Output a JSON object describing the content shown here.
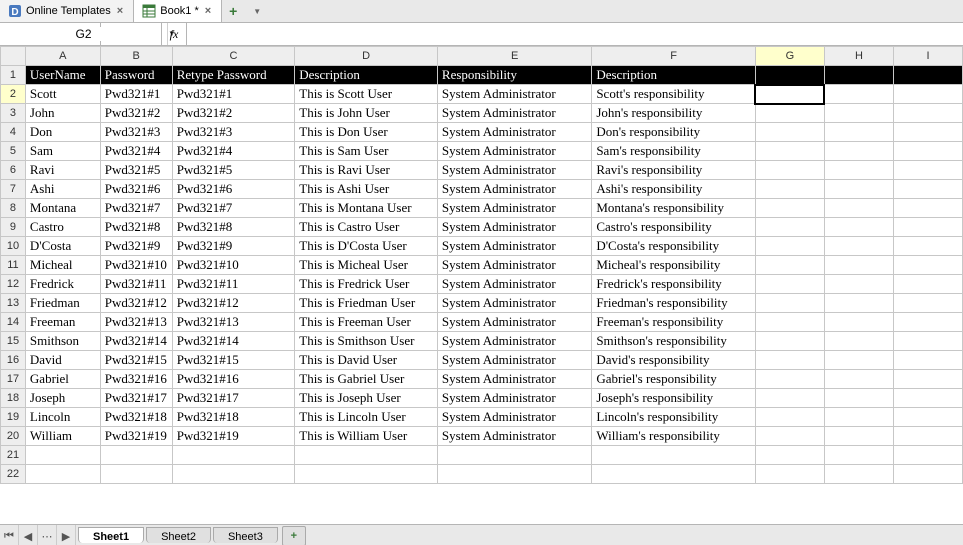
{
  "doc_tabs": [
    {
      "label": "Online Templates",
      "icon": "D",
      "active": false
    },
    {
      "label": "Book1 *",
      "icon": "sheet",
      "active": true
    }
  ],
  "name_box": {
    "value": "G2"
  },
  "fx_label": "fx",
  "formula": {
    "value": ""
  },
  "selection": {
    "col_letter": "G",
    "row_index": 2
  },
  "columns": [
    {
      "letter": "A",
      "width": 75
    },
    {
      "letter": "B",
      "width": 72
    },
    {
      "letter": "C",
      "width": 123
    },
    {
      "letter": "D",
      "width": 143
    },
    {
      "letter": "E",
      "width": 155
    },
    {
      "letter": "F",
      "width": 164
    },
    {
      "letter": "G",
      "width": 70
    },
    {
      "letter": "H",
      "width": 70
    },
    {
      "letter": "I",
      "width": 70
    }
  ],
  "visible_row_count": 22,
  "header_row_index": 1,
  "chart_data": {
    "type": "table",
    "headers": [
      "UserName",
      "Password",
      "Retype Password",
      "Description",
      "Responsibility",
      "Description"
    ],
    "rows": [
      [
        "Scott",
        "Pwd321#1",
        "Pwd321#1",
        "This is Scott User",
        "System Administrator",
        "Scott's responsibility"
      ],
      [
        "John",
        "Pwd321#2",
        "Pwd321#2",
        "This is John User",
        "System Administrator",
        "John's responsibility"
      ],
      [
        "Don",
        "Pwd321#3",
        "Pwd321#3",
        "This is Don User",
        "System Administrator",
        "Don's responsibility"
      ],
      [
        "Sam",
        "Pwd321#4",
        "Pwd321#4",
        "This is Sam User",
        "System Administrator",
        "Sam's responsibility"
      ],
      [
        "Ravi",
        "Pwd321#5",
        "Pwd321#5",
        "This is Ravi User",
        "System Administrator",
        "Ravi's responsibility"
      ],
      [
        "Ashi",
        "Pwd321#6",
        "Pwd321#6",
        "This is Ashi User",
        "System Administrator",
        "Ashi's responsibility"
      ],
      [
        "Montana",
        "Pwd321#7",
        "Pwd321#7",
        "This is Montana User",
        "System Administrator",
        "Montana's responsibility"
      ],
      [
        "Castro",
        "Pwd321#8",
        "Pwd321#8",
        "This is Castro User",
        "System Administrator",
        "Castro's responsibility"
      ],
      [
        "D'Costa",
        "Pwd321#9",
        "Pwd321#9",
        "This is D'Costa User",
        "System Administrator",
        "D'Costa's responsibility"
      ],
      [
        "Micheal",
        "Pwd321#10",
        "Pwd321#10",
        "This is Micheal User",
        "System Administrator",
        "Micheal's responsibility"
      ],
      [
        "Fredrick",
        "Pwd321#11",
        "Pwd321#11",
        "This is Fredrick User",
        "System Administrator",
        "Fredrick's responsibility"
      ],
      [
        "Friedman",
        "Pwd321#12",
        "Pwd321#12",
        "This is Friedman User",
        "System Administrator",
        "Friedman's responsibility"
      ],
      [
        "Freeman",
        "Pwd321#13",
        "Pwd321#13",
        "This is Freeman User",
        "System Administrator",
        "Freeman's responsibility"
      ],
      [
        "Smithson",
        "Pwd321#14",
        "Pwd321#14",
        "This is Smithson User",
        "System Administrator",
        "Smithson's responsibility"
      ],
      [
        "David",
        "Pwd321#15",
        "Pwd321#15",
        "This is David User",
        "System Administrator",
        "David's responsibility"
      ],
      [
        "Gabriel",
        "Pwd321#16",
        "Pwd321#16",
        "This is Gabriel User",
        "System Administrator",
        "Gabriel's responsibility"
      ],
      [
        "Joseph",
        "Pwd321#17",
        "Pwd321#17",
        "This is Joseph User",
        "System Administrator",
        "Joseph's responsibility"
      ],
      [
        "Lincoln",
        "Pwd321#18",
        "Pwd321#18",
        "This is Lincoln User",
        "System Administrator",
        "Lincoln's responsibility"
      ],
      [
        "William",
        "Pwd321#19",
        "Pwd321#19",
        "This is William User",
        "System Administrator",
        "William's responsibility"
      ]
    ]
  },
  "sheet_tabs": [
    {
      "label": "Sheet1",
      "active": true
    },
    {
      "label": "Sheet2",
      "active": false
    },
    {
      "label": "Sheet3",
      "active": false
    }
  ],
  "nav_icons": {
    "first": "⏮",
    "prev": "◀",
    "more": "⋯",
    "next": "▶",
    "add": "+"
  }
}
